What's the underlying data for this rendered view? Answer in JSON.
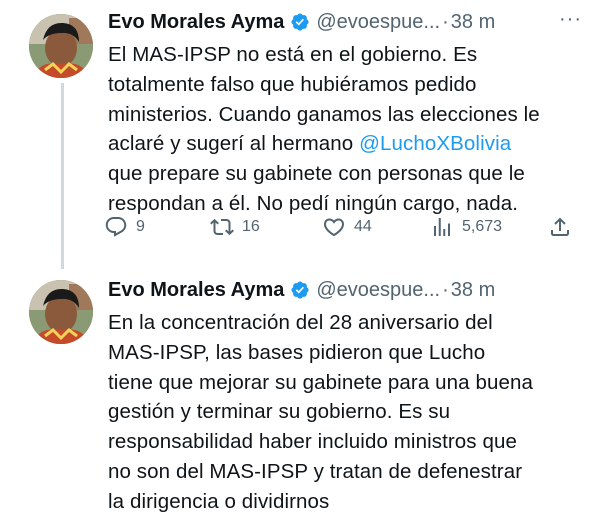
{
  "tweets": [
    {
      "author": {
        "name": "Evo Morales Ayma",
        "handle": "@evoespue...",
        "verified": true
      },
      "separator": "·",
      "time": "38 m",
      "more_label": "···",
      "text": {
        "line1": "El MAS-IPSP no está en el gobierno. Es",
        "line2": "totalmente falso que hubiéramos pedido",
        "line3": "ministerios. Cuando ganamos las elecciones le",
        "line4_pre": "aclaré y sugerí al hermano ",
        "line4_mention": "@LuchoXBolivia",
        "line5": "que prepare su gabinete con personas que le",
        "line6": "respondan a él. No pedí ningún cargo, nada."
      },
      "actions": {
        "replies": "9",
        "reposts": "16",
        "likes": "44",
        "views": "5,673"
      }
    },
    {
      "author": {
        "name": "Evo Morales Ayma",
        "handle": "@evoespue...",
        "verified": true
      },
      "separator": "·",
      "time": "38 m",
      "more_label": "···",
      "text": {
        "line1": "En la concentración del 28 aniversario del",
        "line2": "MAS-IPSP, las bases pidieron que Lucho",
        "line3": "tiene que mejorar su gabinete para una buena",
        "line4": "gestión y terminar su gobierno. Es su",
        "line5": "responsabilidad haber incluido ministros que",
        "line6": "no son del MAS-IPSP y tratan de defenestrar",
        "line7": "la dirigencia o dividirnos"
      }
    }
  ],
  "icons": {
    "reply": "reply-icon",
    "repost": "repost-icon",
    "like": "heart-icon",
    "views": "views-icon",
    "share": "share-icon",
    "verified": "verified-badge-icon"
  },
  "colors": {
    "mention": "#1d9bf0",
    "secondary_text": "#536471",
    "thread_line": "#cfd9de",
    "verified": "#1d9bf0"
  }
}
